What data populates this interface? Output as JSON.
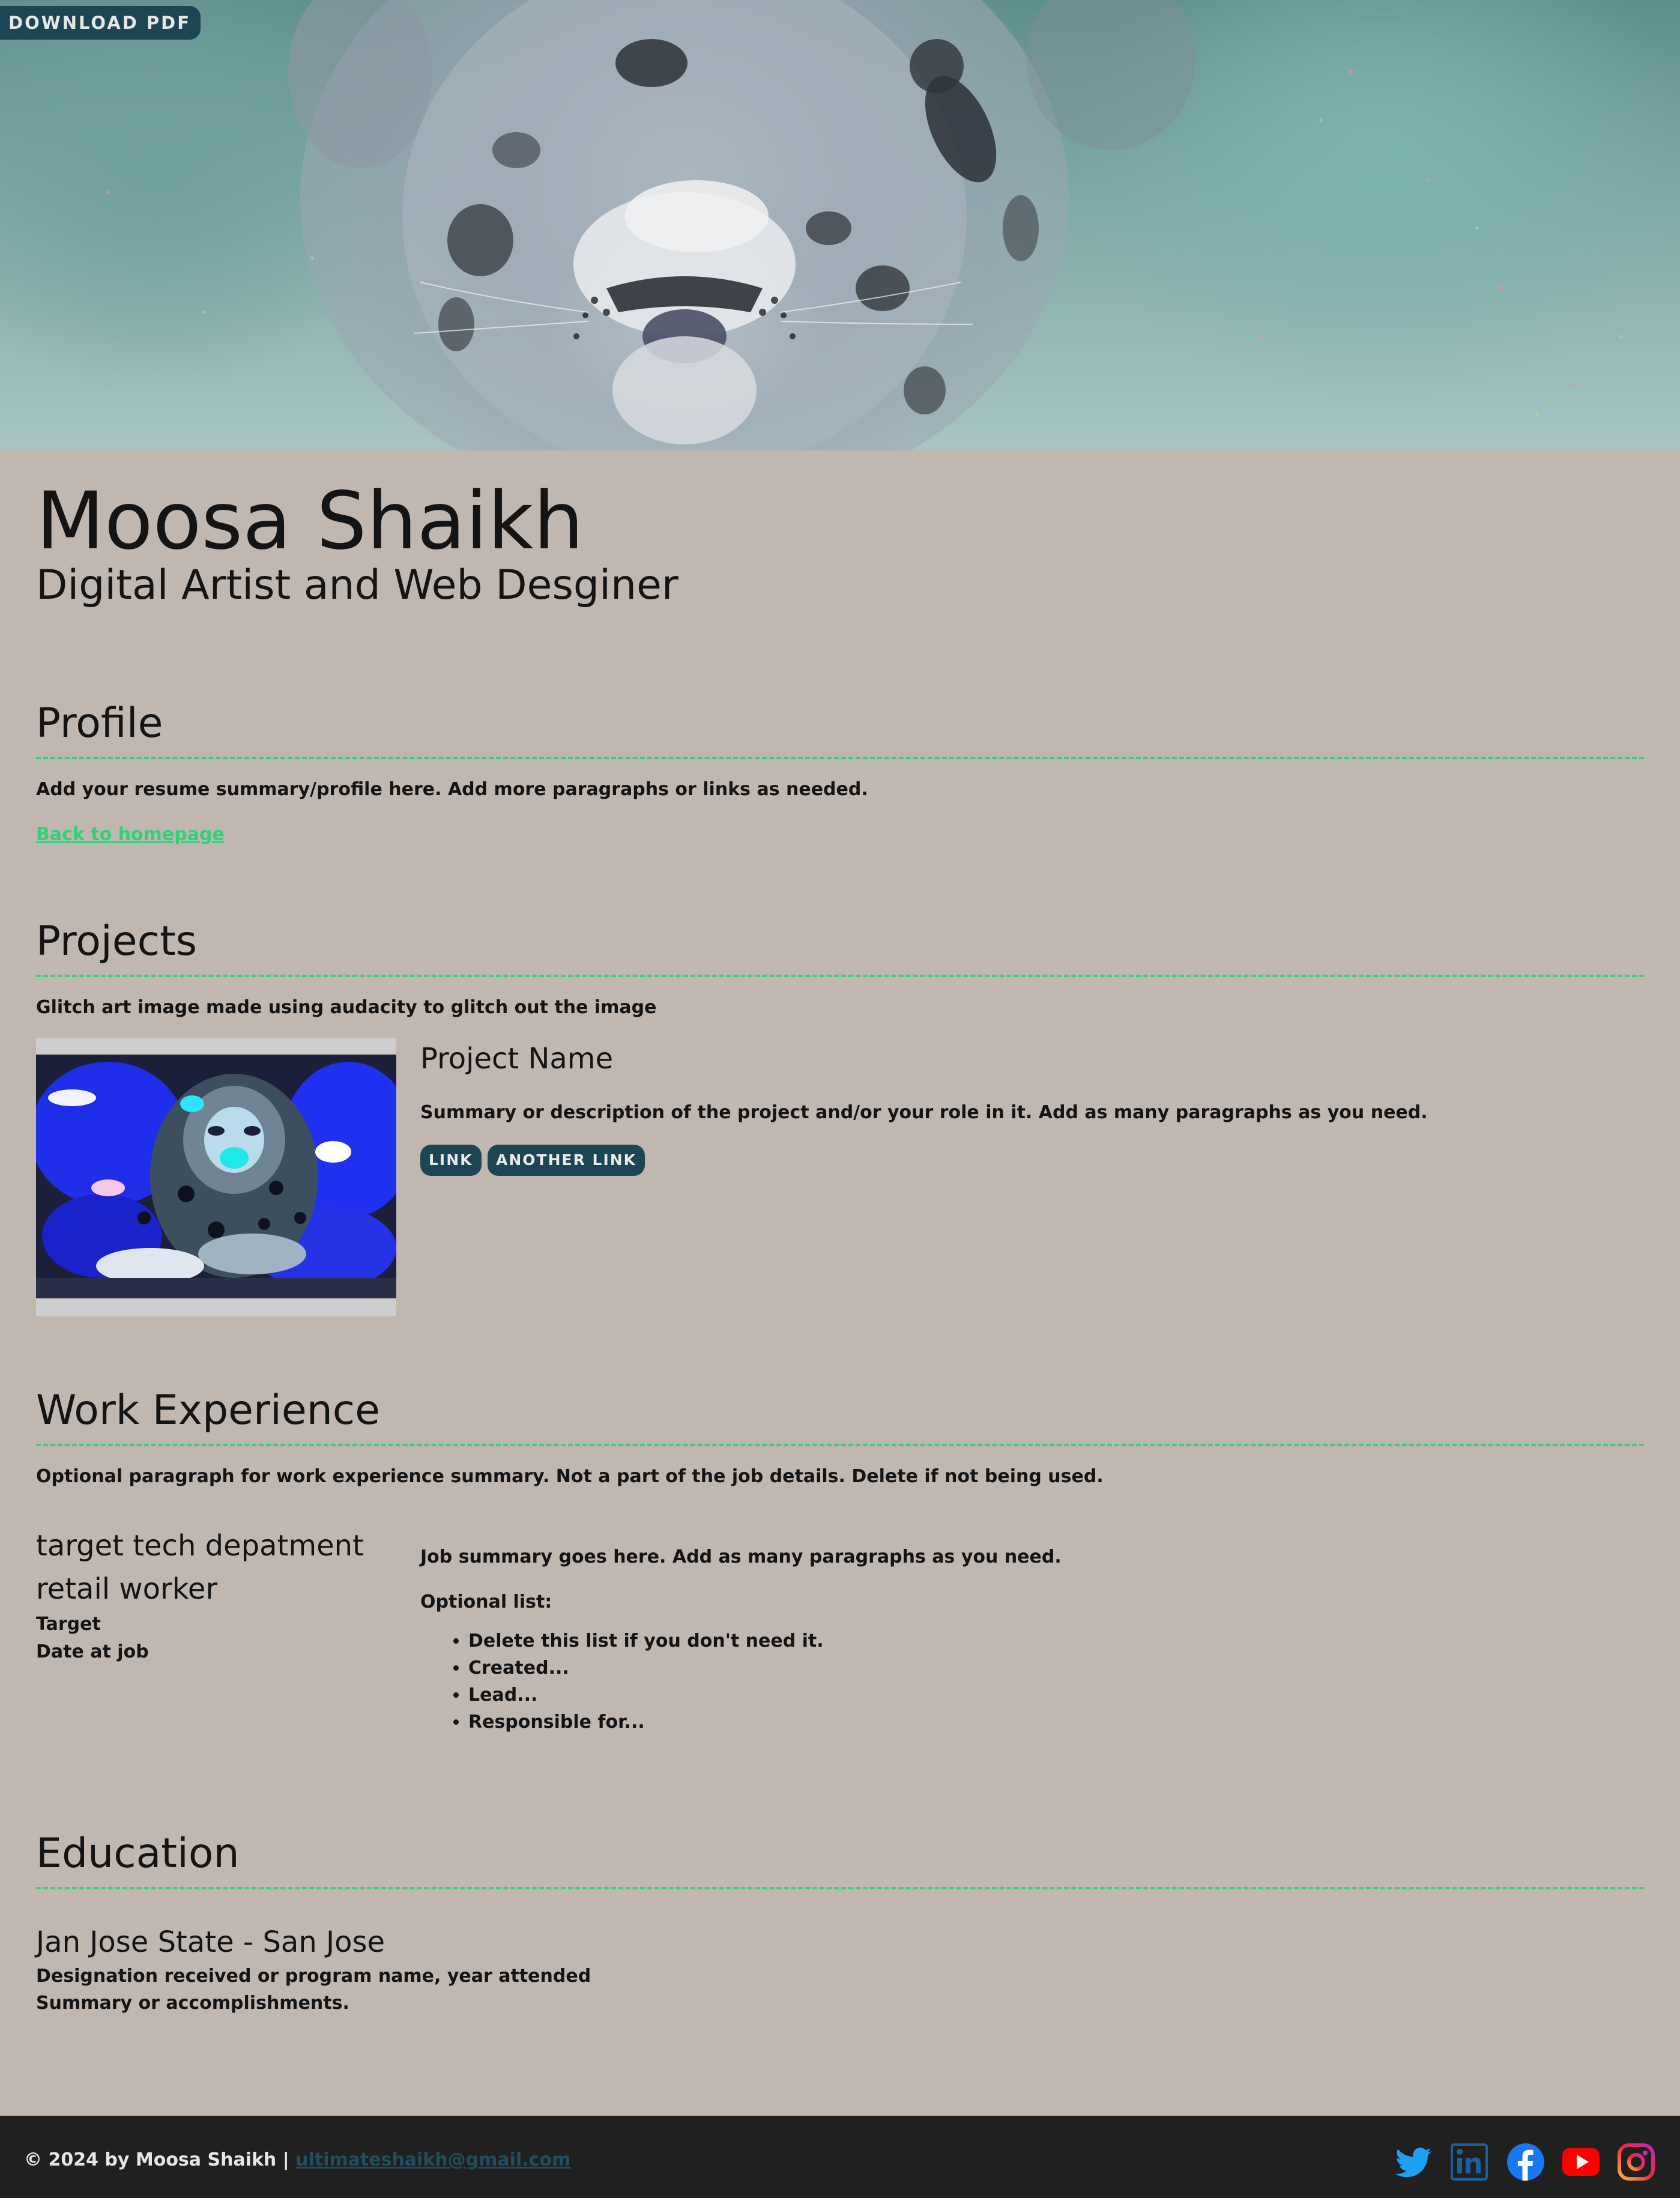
{
  "header": {
    "download_label": "DOWNLOAD PDF"
  },
  "intro": {
    "name": "Moosa Shaikh",
    "tagline": "Digital Artist and Web Desginer"
  },
  "profile": {
    "heading": "Profile",
    "summary": "Add your resume summary/profile here. Add more paragraphs or links as needed.",
    "back_link": "Back to homepage"
  },
  "projects": {
    "heading": "Projects",
    "intro": "Glitch art image made using audacity to glitch out the image",
    "items": [
      {
        "name": "Project Name",
        "summary": "Summary or description of the project and/or your role in it. Add as many paragraphs as you need.",
        "links": [
          "LINK",
          "ANOTHER LINK"
        ]
      }
    ]
  },
  "work": {
    "heading": "Work Experience",
    "intro": "Optional paragraph for work experience summary. Not a part of the job details. Delete if not being used.",
    "jobs": [
      {
        "title_line1": "target tech depatment",
        "title_line2": "retail worker",
        "company": "Target",
        "date": "Date at job",
        "summary": "Job summary goes here. Add as many paragraphs as you need.",
        "list_label": "Optional list:",
        "list": [
          "Delete this list if you don't need it.",
          "Created...",
          "Lead...",
          "Responsible for..."
        ]
      }
    ]
  },
  "education": {
    "heading": "Education",
    "items": [
      {
        "school": "Jan Jose State - San Jose",
        "designation": "Designation received or program name, year attended",
        "summary": "Summary or accomplishments."
      }
    ]
  },
  "footer": {
    "copyright": "© 2024 by Moosa Shaikh |",
    "email": "ultimateshaikh@gmail.com",
    "social": [
      "twitter-icon",
      "linkedin-icon",
      "facebook-icon",
      "youtube-icon",
      "instagram-icon"
    ]
  },
  "colors": {
    "page_bg": "#c1b7b1",
    "accent_dash": "#35d27c",
    "button_bg": "#1d4654",
    "footer_bg": "#202020"
  }
}
